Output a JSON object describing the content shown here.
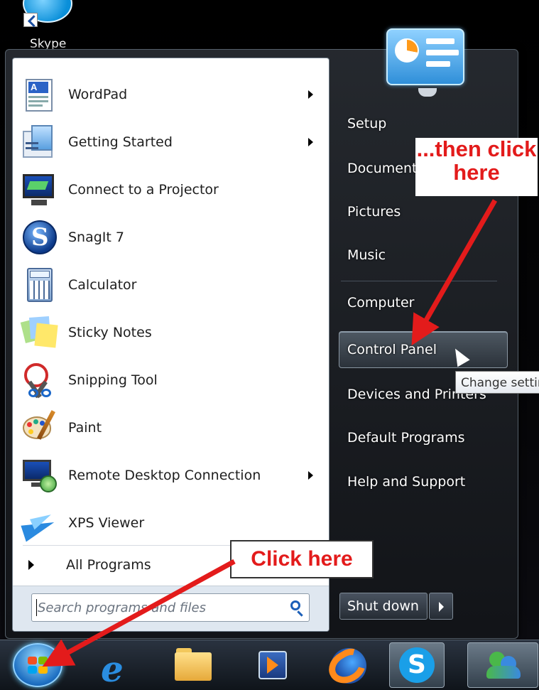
{
  "desktop": {
    "skype_shortcut_label": "Skype"
  },
  "start_menu": {
    "programs": [
      {
        "label": "WordPad",
        "icon": "wordpad-icon",
        "has_submenu": true
      },
      {
        "label": "Getting Started",
        "icon": "getting-started-icon",
        "has_submenu": true
      },
      {
        "label": "Connect to a Projector",
        "icon": "projector-icon",
        "has_submenu": false
      },
      {
        "label": "SnagIt 7",
        "icon": "snagit-icon",
        "has_submenu": false
      },
      {
        "label": "Calculator",
        "icon": "calculator-icon",
        "has_submenu": false
      },
      {
        "label": "Sticky Notes",
        "icon": "sticky-notes-icon",
        "has_submenu": false
      },
      {
        "label": "Snipping Tool",
        "icon": "scissors-icon",
        "has_submenu": false
      },
      {
        "label": "Paint",
        "icon": "paint-palette-icon",
        "has_submenu": false
      },
      {
        "label": "Remote Desktop Connection",
        "icon": "remote-desktop-icon",
        "has_submenu": true
      },
      {
        "label": "XPS Viewer",
        "icon": "xps-viewer-icon",
        "has_submenu": false
      }
    ],
    "all_programs_label": "All Programs",
    "search_placeholder": "Search programs and files",
    "right_items": [
      {
        "label": "Setup"
      },
      {
        "label": "Documents"
      },
      {
        "label": "Pictures"
      },
      {
        "label": "Music"
      },
      {
        "label": "Computer"
      },
      {
        "label": "Control Panel"
      },
      {
        "label": "Devices and Printers"
      },
      {
        "label": "Default Programs"
      },
      {
        "label": "Help and Support"
      }
    ],
    "tooltip": "Change settings",
    "shutdown_label": "Shut down"
  },
  "annotations": {
    "then_callout": "...then click here",
    "click_callout": "Click here",
    "arrow_color": "#e31b1b"
  },
  "taskbar": {
    "icons": [
      "start-orb-icon",
      "internet-explorer-icon",
      "folder-icon",
      "media-player-icon",
      "firefox-icon",
      "skype-icon",
      "messenger-icon"
    ]
  },
  "colors": {
    "menu_bg": "#1a1d22",
    "left_pane_bg": "#ffffff",
    "search_area_bg": "#dfe7f0",
    "annotation_red": "#e31b1b"
  }
}
